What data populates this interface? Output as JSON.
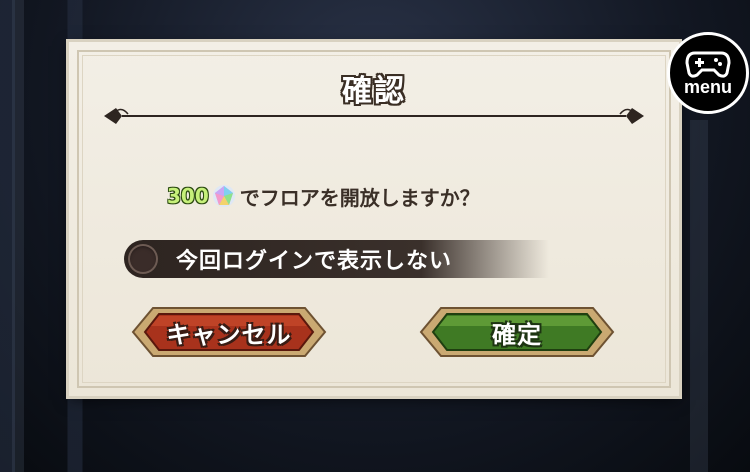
{
  "dialog": {
    "title": "確認",
    "message": {
      "cost": "300",
      "gem_icon": "rainbow-gem-icon",
      "text": "でフロアを開放しますか？"
    },
    "dont_show_again": {
      "label": "今回ログインで表示しない",
      "checked": false
    },
    "cancel_label": "キャンセル",
    "confirm_label": "確定"
  },
  "menu_button": {
    "icon": "gamepad-icon",
    "label": "menu"
  },
  "colors": {
    "cancel_button": "#a8321c",
    "confirm_button": "#3f7a24",
    "dialog_bg": "#efe9dc",
    "cost_text": "#c6f07a"
  }
}
